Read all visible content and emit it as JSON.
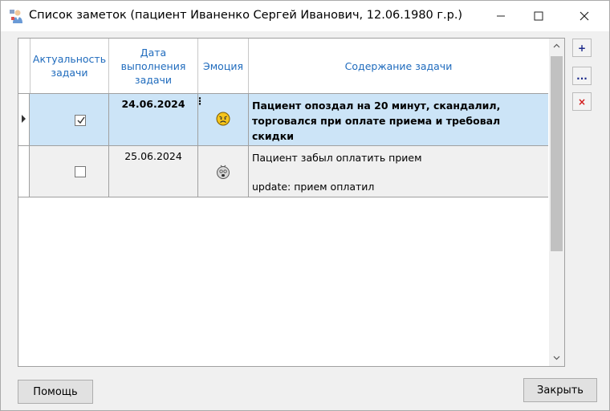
{
  "window": {
    "title": "Список заметок (пациент Иваненко Сергей Иванович, 12.06.1980 г.р.)"
  },
  "grid": {
    "columns": [
      {
        "key": "relevance",
        "label_lines": [
          "Актуальность",
          "задачи"
        ]
      },
      {
        "key": "due_date",
        "label_lines": [
          "Дата",
          "выполнения",
          "задачи"
        ]
      },
      {
        "key": "emotion",
        "label_lines": [
          "Эмоция"
        ]
      },
      {
        "key": "content",
        "label_lines": [
          "Содержание задачи"
        ]
      }
    ],
    "rows": [
      {
        "selected": true,
        "relevant": true,
        "due_date": "24.06.2024",
        "emotion_icon": "angry-face-icon",
        "content_lines": [
          "Пациент опоздал на 20 минут, скандалил,",
          "торговался при оплате приема и требовал скидки"
        ]
      },
      {
        "selected": false,
        "relevant": false,
        "due_date": "25.06.2024",
        "emotion_icon": "shocked-face-icon",
        "content_line1": "Пациент забыл оплатить прием",
        "content_line2": "update: прием оплатил"
      }
    ]
  },
  "side_buttons": {
    "add": "+",
    "edit": "...",
    "delete": "×"
  },
  "buttons": {
    "help": "Помощь",
    "close": "Закрыть"
  },
  "colors": {
    "header_text": "#1f6bbd",
    "selected_row": "#cce4f7",
    "add_edit_icon": "#1c2a8a",
    "delete_icon": "#d21a1a"
  }
}
